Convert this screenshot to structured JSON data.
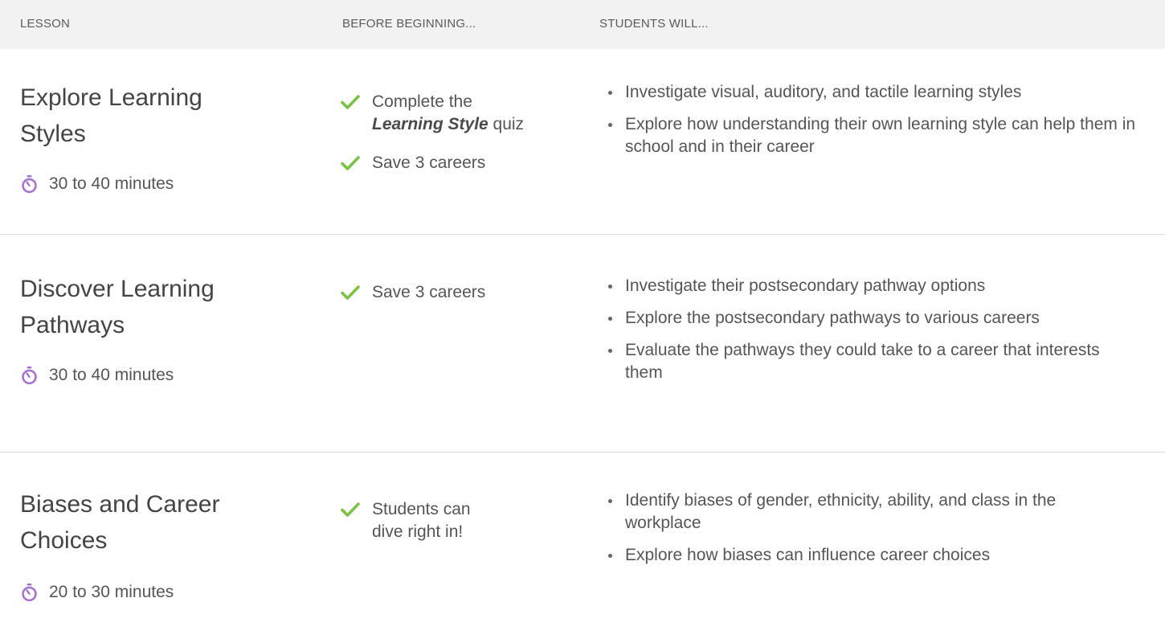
{
  "header": {
    "lesson": "LESSON",
    "before": "BEFORE BEGINNING...",
    "students_will": "STUDENTS WILL..."
  },
  "colors": {
    "check": "#7cc242",
    "timer": "#a36fd3",
    "header_bg": "#f2f2f2",
    "divider": "#dcdcdc"
  },
  "icons": {
    "check": "check-icon",
    "timer": "stopwatch-icon"
  },
  "lessons": [
    {
      "title": "Explore Learning Styles",
      "duration": "30 to 40 minutes",
      "prereqs": [
        {
          "before": "Complete the ",
          "emphasis": "Learning Style",
          "after": " quiz"
        },
        {
          "before": "Save 3 careers",
          "emphasis": "",
          "after": ""
        }
      ],
      "objectives": [
        "Investigate visual, auditory, and tactile learning styles",
        "Explore how understanding their own learning style can help them in school and in their career"
      ]
    },
    {
      "title": "Discover Learning Pathways",
      "duration": "30 to 40 minutes",
      "prereqs": [
        {
          "before": "Save 3 careers",
          "emphasis": "",
          "after": ""
        }
      ],
      "objectives": [
        "Investigate their postsecondary pathway options",
        "Explore the postsecondary pathways to various careers",
        "Evaluate the pathways they could take to a career that interests them"
      ]
    },
    {
      "title": "Biases and Career Choices",
      "duration": "20 to 30 minutes",
      "prereqs": [
        {
          "before": "Students can dive right in!",
          "emphasis": "",
          "after": ""
        }
      ],
      "objectives": [
        "Identify biases of gender, ethnicity, ability, and class in the workplace",
        "Explore how biases can influence career choices"
      ]
    }
  ]
}
